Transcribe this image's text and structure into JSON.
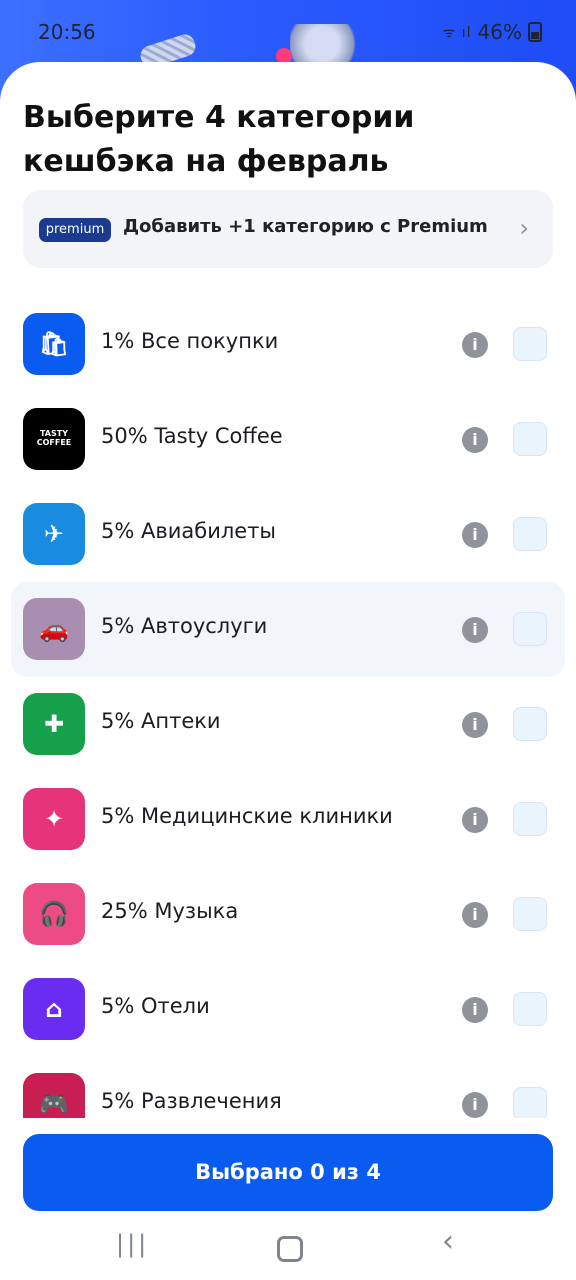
{
  "status_bar": {
    "time": "20:56",
    "signal": "ᯤ ıl",
    "battery": "46%"
  },
  "title": "Выберите 4 категории кешбэка на февраль",
  "promo": {
    "badge": "premium",
    "text": "Добавить +1 категорию с Premium",
    "chevron": "›"
  },
  "categories": [
    {
      "label": "1% Все покупки",
      "icon": "shopping-bag-icon",
      "color": "#0a5cf0",
      "glyph": "🛍"
    },
    {
      "label": "50% Tasty Coffee",
      "icon": "tasty-coffee-logo",
      "color": "#000000",
      "glyph": "TASTY COFFEE"
    },
    {
      "label": "5% Авиабилеты",
      "icon": "airplane-icon",
      "color": "#1a8ce0",
      "glyph": "✈"
    },
    {
      "label": "5% Автоуслуги",
      "icon": "car-service-icon",
      "color": "#a88eb0",
      "glyph": "🚗"
    },
    {
      "label": "5% Аптеки",
      "icon": "pharmacy-icon",
      "color": "#16a04a",
      "glyph": "✚"
    },
    {
      "label": "5% Медицинские клиники",
      "icon": "sparkle-icon",
      "color": "#e6337a",
      "glyph": "✦"
    },
    {
      "label": "25% Музыка",
      "icon": "headphones-icon",
      "color": "#ec4b84",
      "glyph": "🎧"
    },
    {
      "label": "5% Отели",
      "icon": "hotel-icon",
      "color": "#6a2df0",
      "glyph": "⌂"
    },
    {
      "label": "5% Развлечения",
      "icon": "gamepad-icon",
      "color": "#c81e52",
      "glyph": "🎮"
    }
  ],
  "info_glyph": "i",
  "bottom_button": "Выбрано 0 из 4",
  "nav": {
    "recent": "|||",
    "back": "‹"
  }
}
